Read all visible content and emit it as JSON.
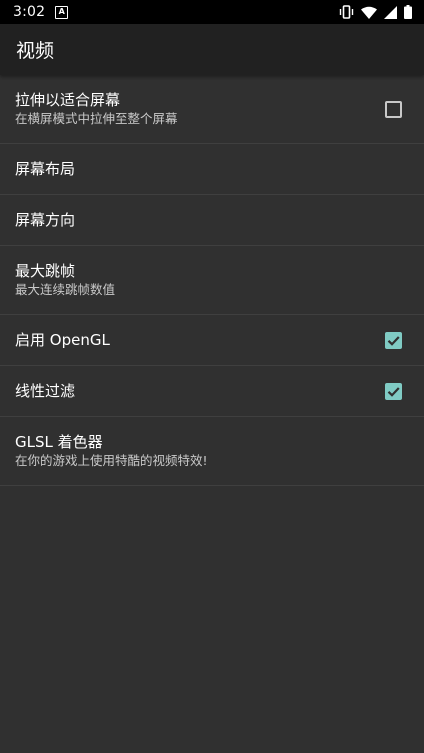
{
  "status_bar": {
    "time": "3:02",
    "notification_glyph": "A",
    "icons": [
      "vibrate-icon",
      "wifi-icon",
      "signal-icon",
      "battery-icon"
    ]
  },
  "toolbar": {
    "title": "视频"
  },
  "preferences": [
    {
      "title": "拉伸以适合屏幕",
      "summary": "在横屏模式中拉伸至整个屏幕",
      "checked": false
    },
    {
      "title": "屏幕布局"
    },
    {
      "title": "屏幕方向"
    },
    {
      "title": "最大跳帧",
      "summary": "最大连续跳帧数值"
    },
    {
      "title": "启用 OpenGL",
      "checked": true
    },
    {
      "title": "线性过滤",
      "checked": true
    },
    {
      "title": "GLSL 着色器",
      "summary": "在你的游戏上使用特酷的视频特效!"
    }
  ],
  "colors": {
    "background": "#303030",
    "toolbar": "#212121",
    "accent": "#80cbc4"
  }
}
